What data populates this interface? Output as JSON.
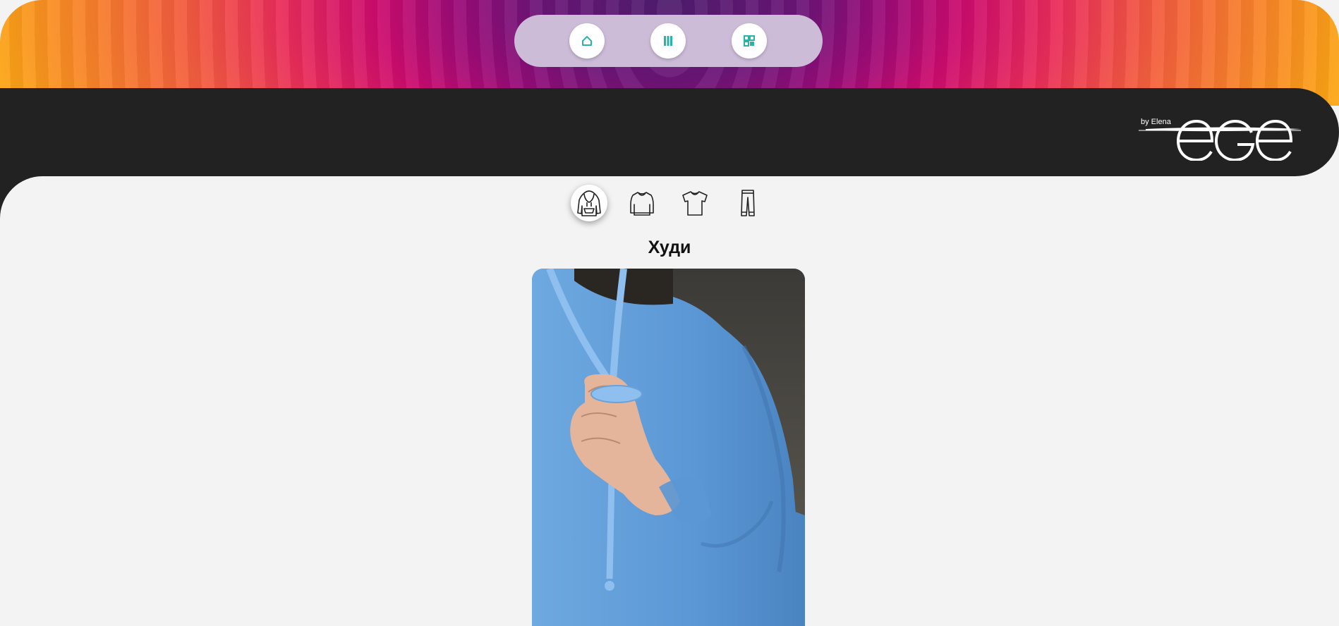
{
  "nav": {
    "buttons": [
      {
        "icon": "home-icon",
        "label": "home"
      },
      {
        "icon": "catalog-icon",
        "label": "catalog"
      },
      {
        "icon": "grid-icon",
        "label": "grid"
      }
    ],
    "accent_color": "#2bb3a8"
  },
  "brand": {
    "logo_text": "ege",
    "byline": "by Elena"
  },
  "categories": [
    {
      "icon": "hoodie-icon",
      "active": true
    },
    {
      "icon": "sweatshirt-icon",
      "active": false
    },
    {
      "icon": "tshirt-icon",
      "active": false
    },
    {
      "icon": "pants-icon",
      "active": false
    }
  ],
  "section": {
    "title": "Худи"
  },
  "product": {
    "image": "blue-hoodie-photo"
  }
}
